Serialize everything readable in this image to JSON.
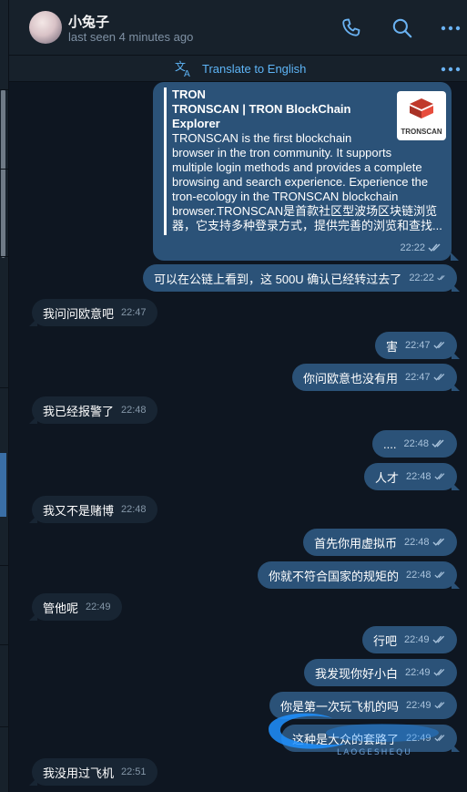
{
  "header": {
    "contact_name": "小兔子",
    "last_seen": "last seen 4 minutes ago",
    "icons": [
      "phone-icon",
      "search-icon",
      "more-icon"
    ]
  },
  "translate_bar": {
    "label": "Translate to English",
    "icons": [
      "translate-icon",
      "more-icon"
    ]
  },
  "link_preview": {
    "site_name": "TRON",
    "title": "TRONSCAN | TRON BlockChain Explorer",
    "description_lines": [
      "TRONSCAN is the first blockchain",
      "browser in the tron community. It supports",
      "multiple login methods and provides a complete",
      "browsing and search experience. Experience the",
      "tron-ecology in the TRONSCAN blockchain",
      "browser.TRONSCAN是首款社区型波场区块链浏览",
      "器，它支持多种登录方式，提供完善的浏览和查找..."
    ],
    "thumbnail_label": "TRONSCAN",
    "time": "22:22"
  },
  "messages": [
    {
      "dir": "out",
      "text": "可以在公链上看到，这 500U 确认已经转过去了",
      "time": "22:22"
    },
    {
      "dir": "in",
      "text": "我问问欧意吧",
      "time": "22:47"
    },
    {
      "dir": "out",
      "text": "害",
      "time": "22:47"
    },
    {
      "dir": "out",
      "text": "你问欧意也没有用",
      "time": "22:47"
    },
    {
      "dir": "in",
      "text": "我已经报警了",
      "time": "22:48"
    },
    {
      "dir": "out",
      "text": "....",
      "time": "22:48"
    },
    {
      "dir": "out",
      "text": "人才",
      "time": "22:48"
    },
    {
      "dir": "in",
      "text": "我又不是赌博",
      "time": "22:48"
    },
    {
      "dir": "out",
      "text": "首先你用虚拟币",
      "time": "22:48"
    },
    {
      "dir": "out",
      "text": "你就不符合国家的规矩的",
      "time": "22:48"
    },
    {
      "dir": "in",
      "text": "管他呢",
      "time": "22:49"
    },
    {
      "dir": "out",
      "text": "行吧",
      "time": "22:49"
    },
    {
      "dir": "out",
      "text": "我发现你好小白",
      "time": "22:49"
    },
    {
      "dir": "out",
      "text": "你是第一次玩飞机的吗",
      "time": "22:49"
    },
    {
      "dir": "out",
      "text": "这种是大众的套路了",
      "time": "22:49"
    },
    {
      "dir": "in",
      "text": "我没用过飞机",
      "time": "22:51"
    }
  ],
  "watermark": "LAOGESHEQU",
  "colors": {
    "background": "#0e1621",
    "panel": "#17212b",
    "outgoing_bubble": "#2b5278",
    "incoming_bubble": "#182533",
    "accent": "#5eb5f7"
  }
}
